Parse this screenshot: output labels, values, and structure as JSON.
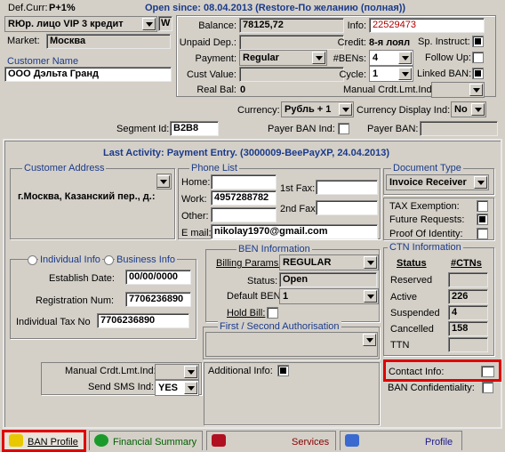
{
  "top": {
    "def_curr_label": "Def.Curr:",
    "def_curr_value": "P+1%",
    "open_since": "Open since: 08.04.2013 (Restore-По желанию (полная))",
    "account_type": "RЮр. лицо VIP 3   кредит",
    "w_button": "W",
    "market_label": "Market:",
    "market_value": "Москва",
    "customer_name_label": "Customer Name",
    "customer_name": "ООО Дэльта Гранд",
    "balance_label": "Balance:",
    "balance_value": "78125,72",
    "unpaid_label": "Unpaid Dep.:",
    "unpaid_value": "",
    "payment_label": "Payment:",
    "payment_value": "Regular",
    "cust_value_label": "Cust Value:",
    "cust_value": "",
    "real_bal_label": "Real Bal:",
    "real_bal_value": "0",
    "info_label": "Info:",
    "info_value": "22529473",
    "credit_label": "Credit:",
    "credit_value": "8-я лоял",
    "bens_label": "#BENs:",
    "bens_value": "4",
    "cycle_label": "Cycle:",
    "cycle_value": "1",
    "manual_label": "Manual Crdt.Lmt.Ind:",
    "sp_instruct_label": "Sp. Instruct:",
    "follow_up_label": "Follow Up:",
    "linked_ban_label": "Linked BAN:",
    "currency_label": "Currency:",
    "currency_value": "Рубль + 1",
    "currency_display_label": "Currency Display Ind:",
    "currency_display_value": "No",
    "payer_ban_ind_label": "Payer BAN Ind:",
    "payer_ban_label": "Payer BAN:",
    "segment_label": "Segment Id:",
    "segment_value": "B2B8"
  },
  "activity": "Last Activity: Payment Entry. (3000009-BeePayXP, 24.04.2013)",
  "address": {
    "title": "Customer Address",
    "value": "г.Москва, Казанский пер., д.:"
  },
  "phones": {
    "title": "Phone List",
    "home_label": "Home:",
    "home": "",
    "work_label": "Work:",
    "work": "4957288782",
    "other_label": "Other:",
    "other": "",
    "fax1_label": "1st Fax:",
    "fax1": "",
    "fax2_label": "2nd Fax",
    "fax2": "",
    "email_label": "E mail:",
    "email": "nikolay1970@gmail.com"
  },
  "doc": {
    "title": "Document Type",
    "value": "Invoice Receiver"
  },
  "flags": {
    "tax_label": "TAX Exemption:",
    "future_label": "Future Requests:",
    "proof_label": "Proof Of Identity:"
  },
  "ctn": {
    "title": "CTN Information",
    "status_hdr": "Status",
    "ctns_hdr": "#CTNs",
    "rows": [
      {
        "status": "Reserved",
        "count": ""
      },
      {
        "status": "Active",
        "count": "226"
      },
      {
        "status": "Suspended",
        "count": "4"
      },
      {
        "status": "Cancelled",
        "count": "158"
      },
      {
        "status": "TTN",
        "count": ""
      }
    ]
  },
  "contact_info_label": "Contact Info:",
  "ban_conf_label": "BAN Confidentiality:",
  "individual": {
    "ind_label": "Individual Info",
    "bus_label": "Business Info",
    "est_label": "Establish Date:",
    "est_value": "00/00/0000",
    "reg_label": "Registration Num:",
    "reg_value": "7706236890",
    "tax_label": "Individual Tax No",
    "tax_value": "7706236890"
  },
  "ben": {
    "title": "BEN Information",
    "billing_label": "Billing Params:",
    "billing_value": "REGULAR",
    "status_label": "Status:",
    "status_value": "Open",
    "default_label": "Default BEN",
    "default_value": "1",
    "hold_label": "Hold Bill:"
  },
  "auth": {
    "title": "First / Second Authorisation"
  },
  "manual2_label": "Manual Crdt.Lmt.Ind:",
  "sms_label": "Send SMS Ind:",
  "sms_value": "YES",
  "additional_label": "Additional Info:",
  "tabs": {
    "ban_profile": "BAN Profile",
    "financial": "Financial Summary",
    "services": "Services",
    "profile": "Profile"
  }
}
